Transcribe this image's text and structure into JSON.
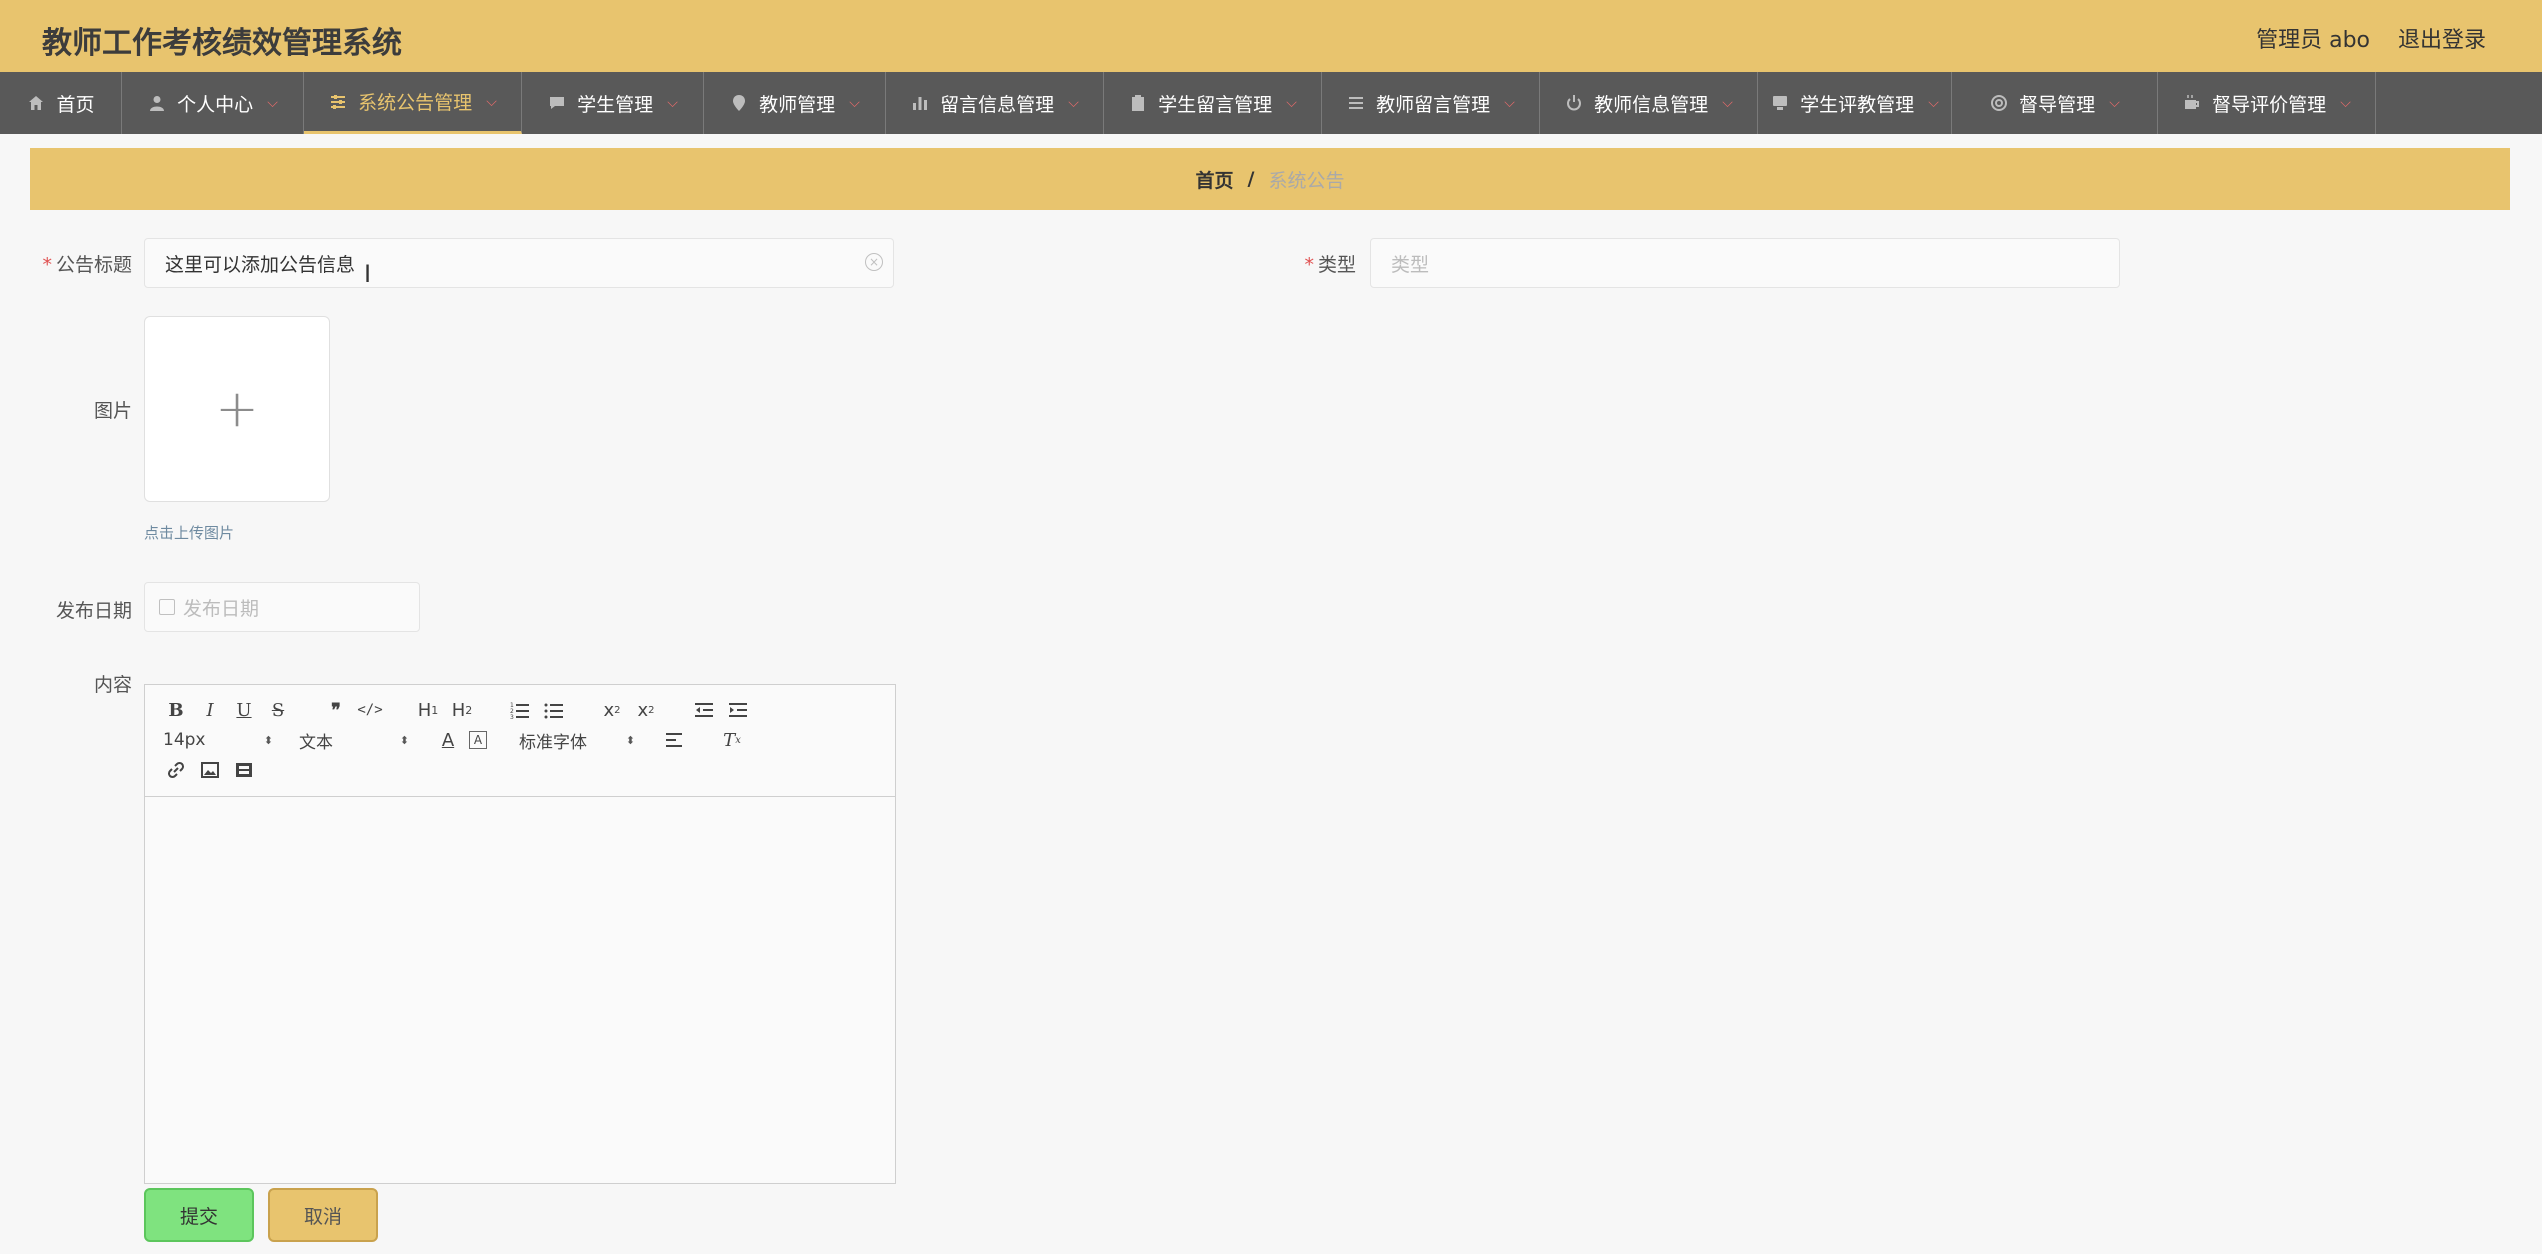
{
  "header": {
    "title": "教师工作考核绩效管理系统",
    "user": "管理员 abo",
    "logout": "退出登录"
  },
  "nav": {
    "items": [
      {
        "label": "首页",
        "icon": "home-icon"
      },
      {
        "label": "个人中心",
        "icon": "user-icon"
      },
      {
        "label": "系统公告管理",
        "icon": "sliders-icon"
      },
      {
        "label": "学生管理",
        "icon": "chat-icon"
      },
      {
        "label": "教师管理",
        "icon": "location-icon"
      },
      {
        "label": "留言信息管理",
        "icon": "bar-chart-icon"
      },
      {
        "label": "学生留言管理",
        "icon": "clipboard-icon"
      },
      {
        "label": "教师留言管理",
        "icon": "list-icon"
      },
      {
        "label": "教师信息管理",
        "icon": "power-icon"
      },
      {
        "label": "学生评教管理",
        "icon": "monitor-icon"
      },
      {
        "label": "督导管理",
        "icon": "lifebuoy-icon"
      },
      {
        "label": "督导评价管理",
        "icon": "coffee-icon"
      }
    ]
  },
  "breadcrumb": {
    "home": "首页",
    "separator": "/",
    "current": "系统公告"
  },
  "form": {
    "title_label": "公告标题",
    "title_value": "这里可以添加公告信息",
    "type_label": "类型",
    "type_placeholder": "类型",
    "image_label": "图片",
    "upload_tip": "点击上传图片",
    "date_label": "发布日期",
    "date_placeholder": "发布日期",
    "content_label": "内容"
  },
  "editor": {
    "font_size": "14px",
    "block_type": "文本",
    "font_family": "标准字体"
  },
  "buttons": {
    "submit": "提交",
    "cancel": "取消"
  },
  "colors": {
    "accent": "#e8c46e",
    "nav_bg": "#595959",
    "submit": "#7fe37f"
  }
}
